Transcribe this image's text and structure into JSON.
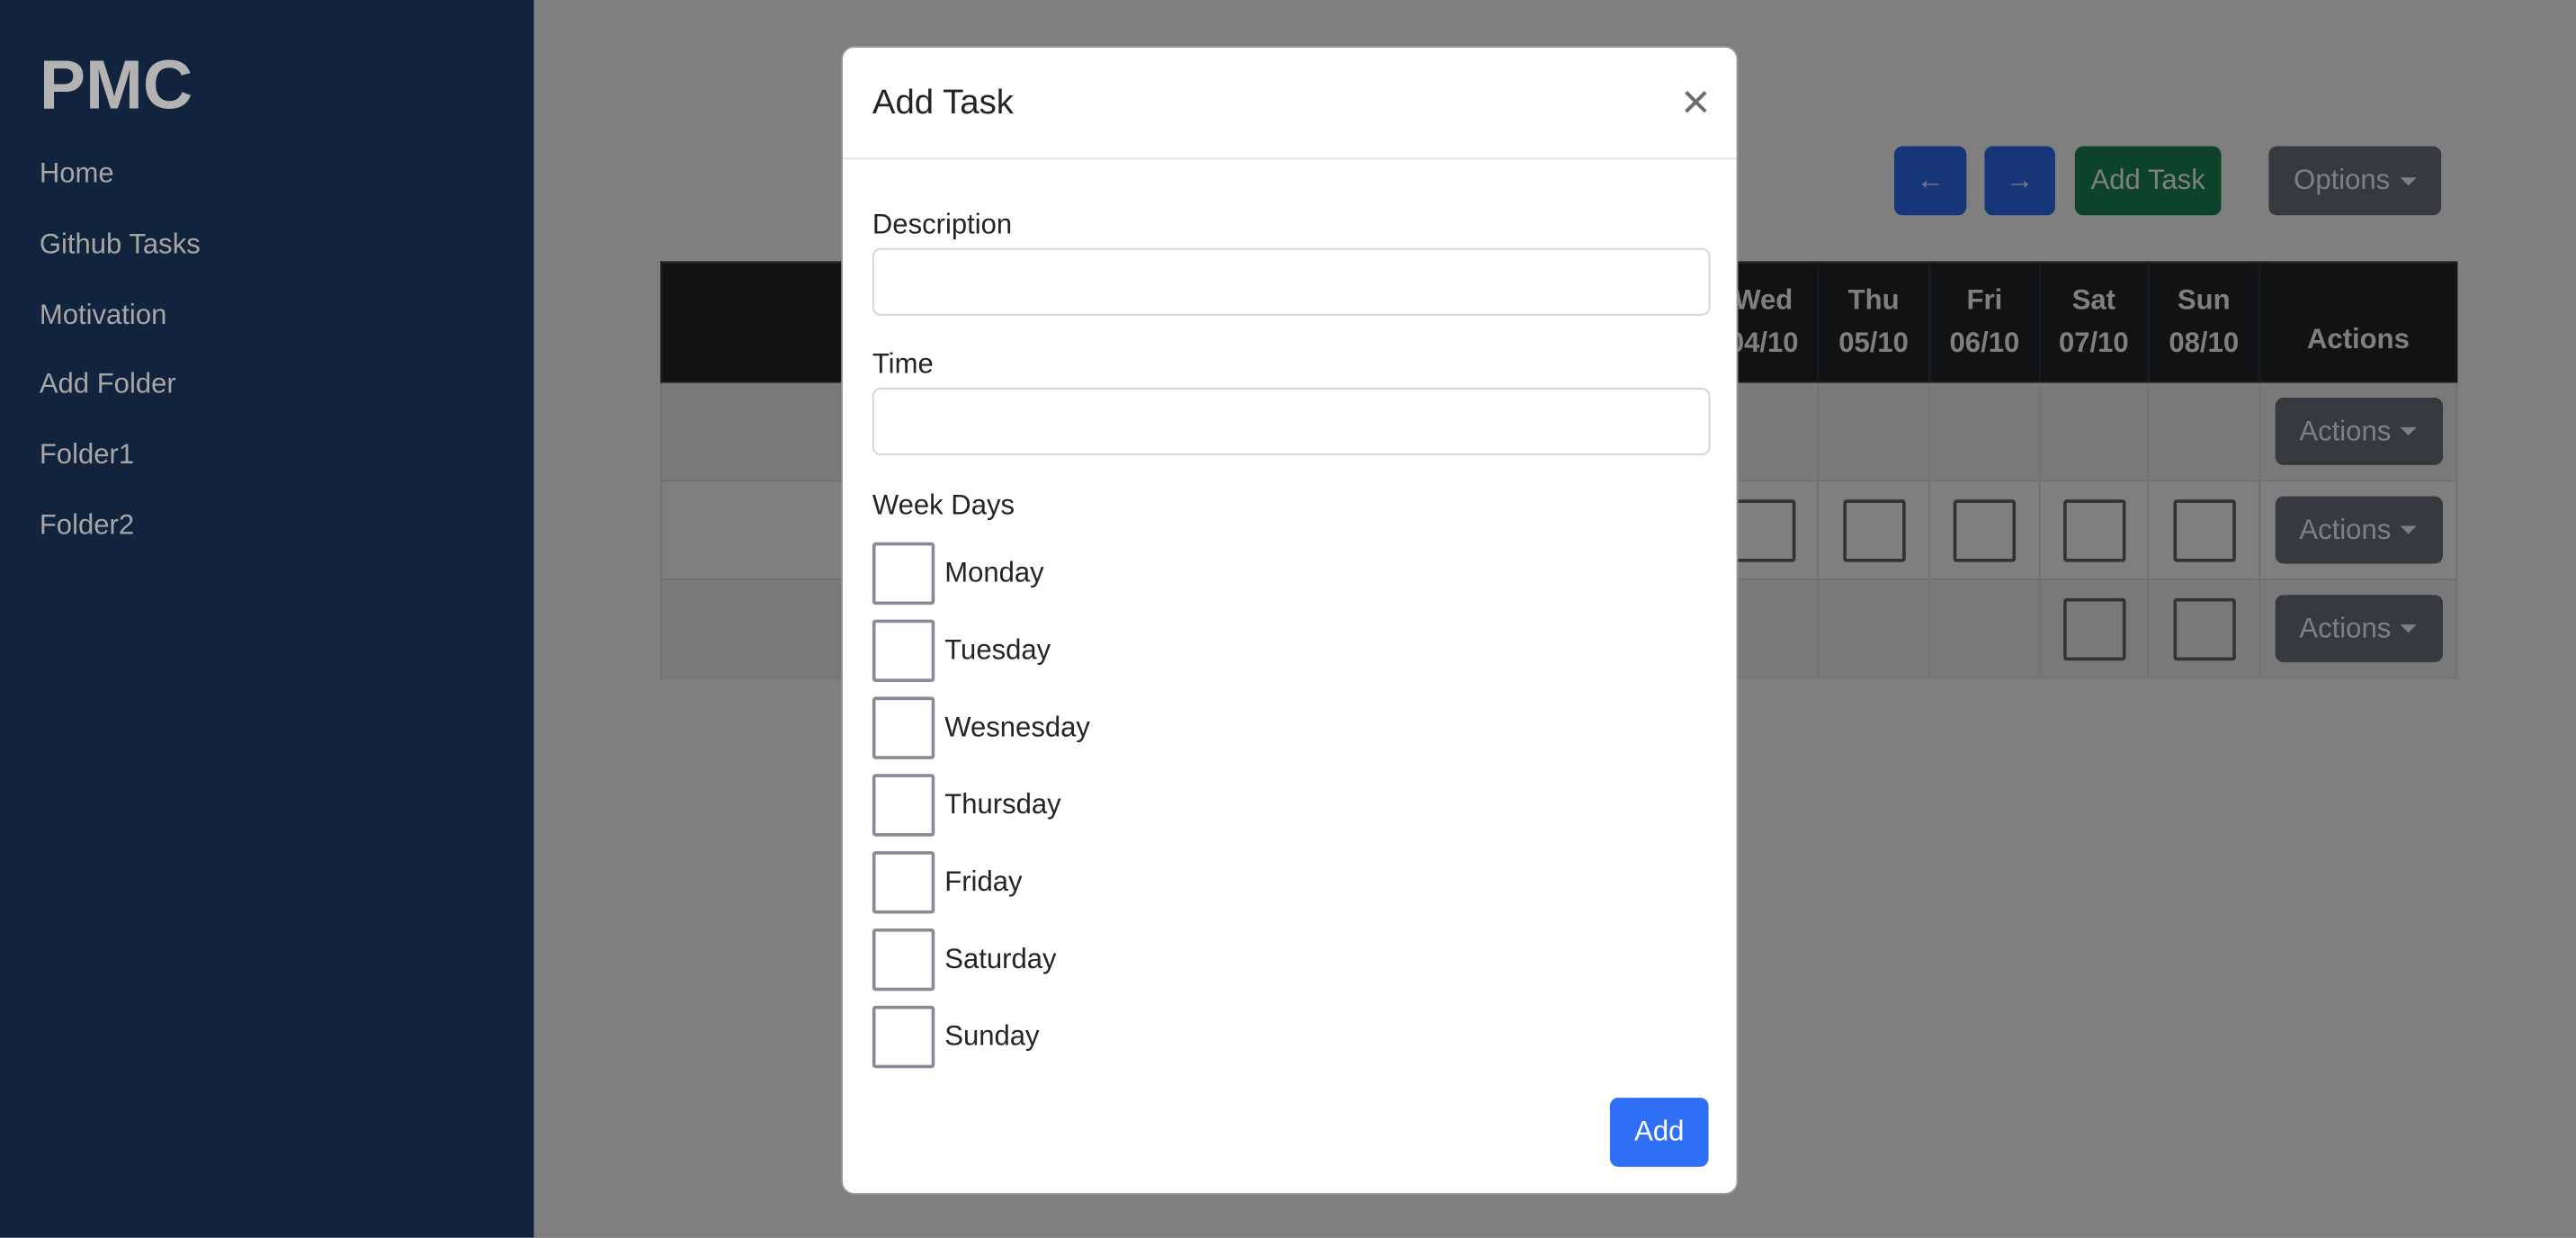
{
  "sidebar": {
    "brand": "PMC",
    "items": [
      "Home",
      "Github Tasks",
      "Motivation",
      "Add Folder",
      "Folder1",
      "Folder2"
    ]
  },
  "toolbar": {
    "prev_icon": "arrow-left-icon",
    "prev": "←",
    "next": "→",
    "add_task": "Add Task",
    "options": "Options"
  },
  "table": {
    "headers": [
      {
        "day": "Wed",
        "date": "04/10"
      },
      {
        "day": "Thu",
        "date": "05/10"
      },
      {
        "day": "Fri",
        "date": "06/10"
      },
      {
        "day": "Sat",
        "date": "07/10"
      },
      {
        "day": "Sun",
        "date": "08/10"
      }
    ],
    "actions_header": "Actions",
    "row_action": "Actions"
  },
  "modal": {
    "title": "Add Task",
    "close": "×",
    "description_label": "Description",
    "description_value": "",
    "time_label": "Time",
    "time_value": "",
    "weekdays_label": "Week Days",
    "days": [
      "Monday",
      "Tuesday",
      "Wesnesday",
      "Thursday",
      "Friday",
      "Saturday",
      "Sunday"
    ],
    "submit": "Add"
  },
  "colors": {
    "sidebar": "#12233e",
    "primary": "#2e6bf2",
    "success": "#198754",
    "secondary": "#6c757d",
    "table_header": "#212529"
  }
}
